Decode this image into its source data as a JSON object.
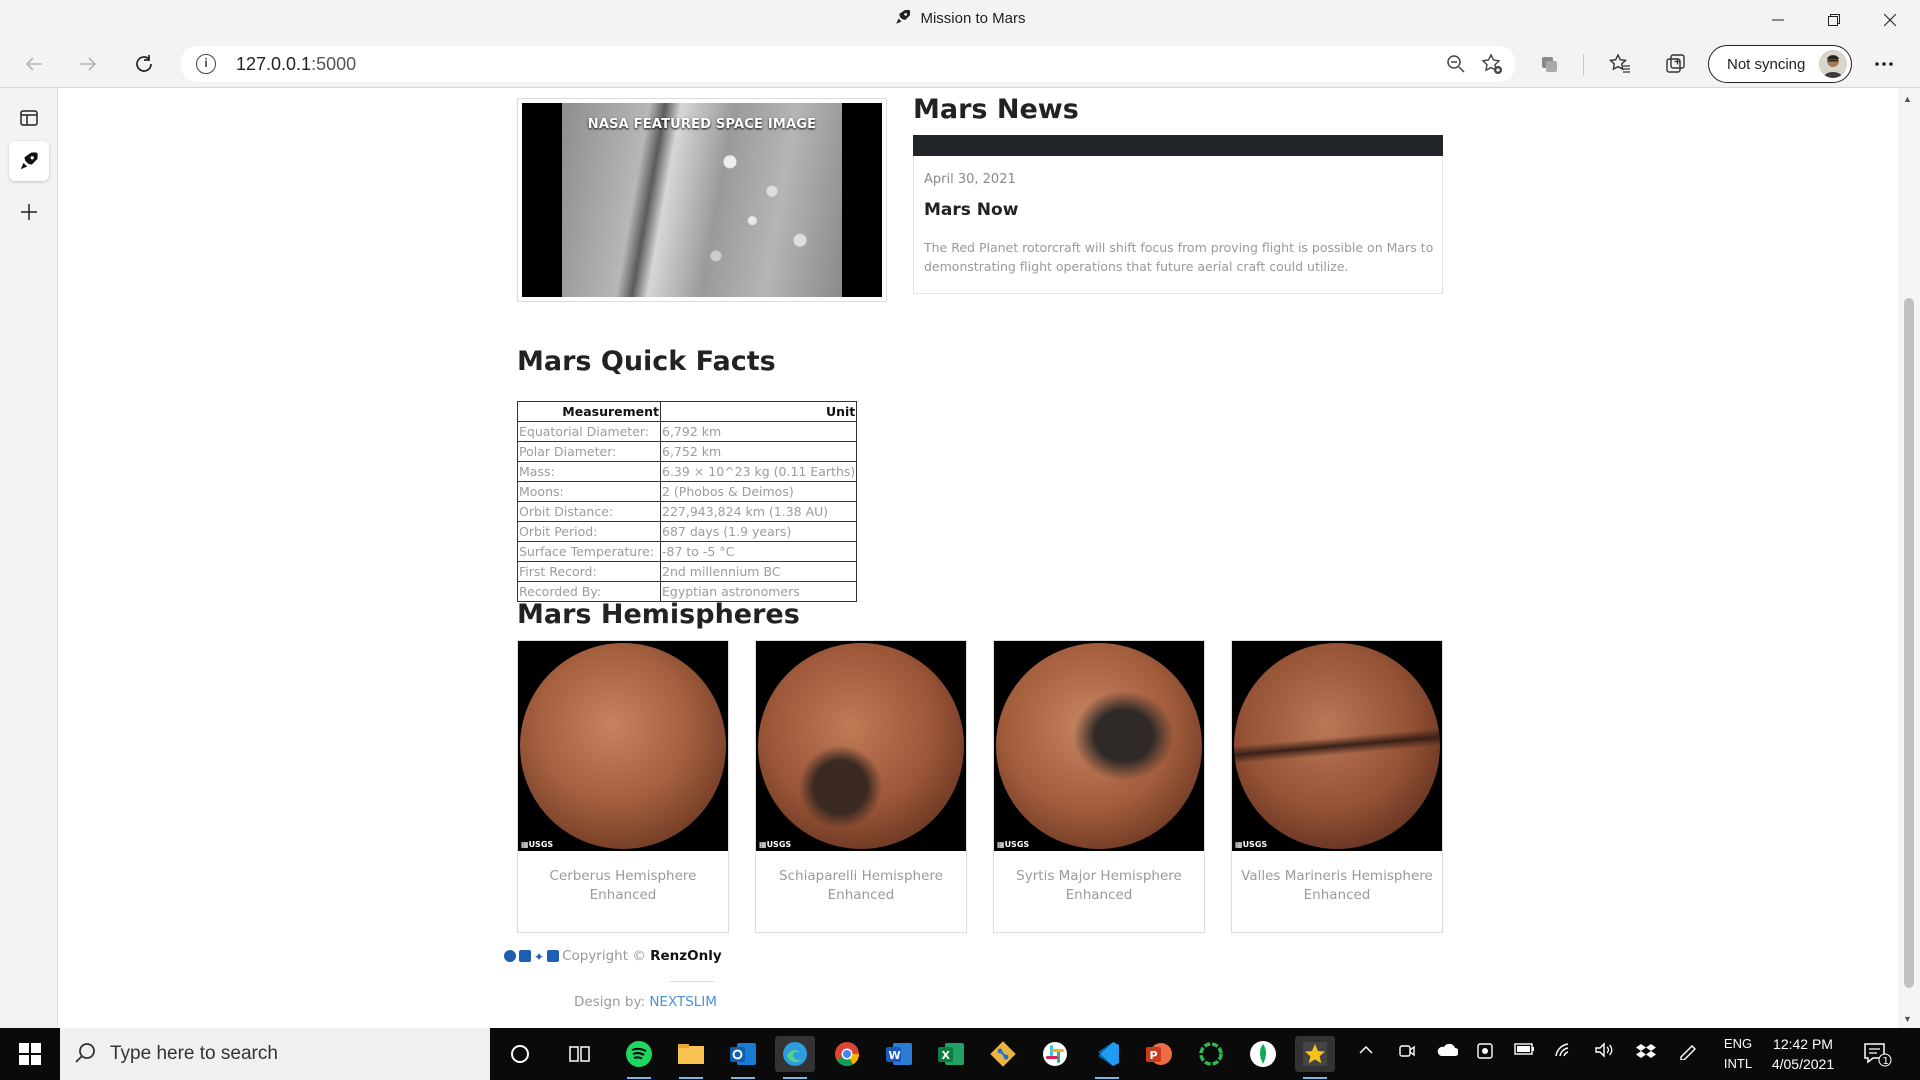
{
  "window": {
    "title": "Mission to Mars",
    "controls": [
      "minimize",
      "restore",
      "close"
    ]
  },
  "browser": {
    "url_host": "127.0.0.1",
    "url_port": ":5000",
    "sync_label": "Not syncing",
    "toolbar_icons": [
      "zoom-out-icon",
      "add-favorite-icon",
      "extensions-icon",
      "favorites-icon",
      "collections-icon",
      "more-icon"
    ]
  },
  "page": {
    "featured_caption": "NASA FEATURED SPACE IMAGE",
    "news_heading": "Mars News",
    "news": {
      "date": "April 30, 2021",
      "title": "Mars Now",
      "paragraph": "The Red Planet rotorcraft will shift focus from proving flight is possible on Mars to demonstrating flight operations that future aerial craft could utilize."
    },
    "facts_heading": "Mars Quick Facts",
    "facts_table": {
      "headers": [
        "Measurement",
        "Unit"
      ],
      "rows": [
        [
          "Equatorial Diameter:",
          "6,792 km"
        ],
        [
          "Polar Diameter:",
          "6,752 km"
        ],
        [
          "Mass:",
          "6.39 × 10^23 kg (0.11 Earths)"
        ],
        [
          "Moons:",
          "2 (Phobos & Deimos)"
        ],
        [
          "Orbit Distance:",
          "227,943,824 km (1.38 AU)"
        ],
        [
          "Orbit Period:",
          "687 days (1.9 years)"
        ],
        [
          "Surface Temperature:",
          "-87 to -5 °C"
        ],
        [
          "First Record:",
          "2nd millennium BC"
        ],
        [
          "Recorded By:",
          "Egyptian astronomers"
        ]
      ]
    },
    "hemispheres_heading": "Mars Hemispheres",
    "hemispheres": [
      {
        "title": "Cerberus Hemisphere Enhanced",
        "logo": "USGS"
      },
      {
        "title": "Schiaparelli Hemisphere Enhanced",
        "logo": "USGS"
      },
      {
        "title": "Syrtis Major Hemisphere Enhanced",
        "logo": "USGS"
      },
      {
        "title": "Valles Marineris Hemisphere Enhanced",
        "logo": "USGS"
      }
    ],
    "footer": {
      "copyright_prefix": "Copyright © ",
      "author": "RenzOnly",
      "design_by": "Design by: ",
      "design_link": "NEXTSLIM"
    }
  },
  "taskbar": {
    "search_placeholder": "Type here to search",
    "lang_line1": "ENG",
    "lang_line2": "INTL",
    "time": "12:42 PM",
    "date": "4/05/2021",
    "notification_count": "1",
    "apps": [
      "task-view",
      "spotify",
      "file-explorer",
      "outlook",
      "edge",
      "chrome",
      "word",
      "excel",
      "git",
      "slack",
      "vscode",
      "powerpoint",
      "app-green-ring",
      "mongodb",
      "mission-to-mars"
    ]
  },
  "colors": {
    "chrome_bg": "#f3f3f3",
    "news_bar": "#212529",
    "link_blue": "#4a90d9",
    "taskbar": "#0a0a0a"
  }
}
